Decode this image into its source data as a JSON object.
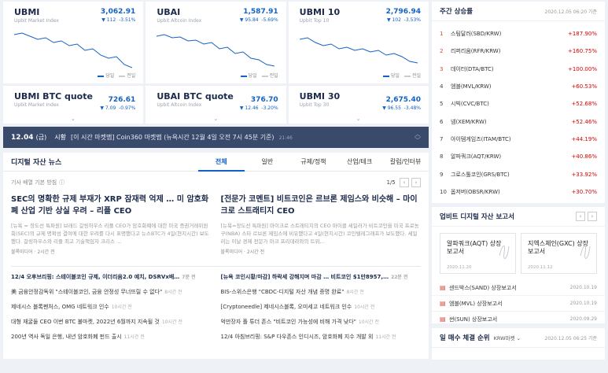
{
  "indices": [
    {
      "name": "UBMI",
      "sub": "Upbit Market Index",
      "value": "3,062.91",
      "change": "▼ 112",
      "rate": "-3.51%"
    },
    {
      "name": "UBAI",
      "sub": "Upbit Altcoin Index",
      "value": "1,587.91",
      "change": "▼ 95.84",
      "rate": "-5.69%"
    },
    {
      "name": "UBMI 10",
      "sub": "Upbit Top 10",
      "value": "2,796.94",
      "change": "▼ 102",
      "rate": "-3.53%"
    },
    {
      "name": "UBMI BTC quote",
      "sub": "Upbit Market Index",
      "value": "726.61",
      "change": "▼ 7.09",
      "rate": "-0.97%"
    },
    {
      "name": "UBAI BTC quote",
      "sub": "Upbit Altcoin Index",
      "value": "376.70",
      "change": "▼ 12.46",
      "rate": "-3.20%"
    },
    {
      "name": "UBMI 30",
      "sub": "Upbit Top 30",
      "value": "2,675.40",
      "change": "▼ 96.55",
      "rate": "-3.48%"
    }
  ],
  "legend": {
    "today": "당일",
    "prev": "전일"
  },
  "colors": {
    "accent": "#1261c4",
    "up": "#d60000",
    "ticker_bg": "#3a4a6b"
  },
  "ticker": {
    "date": "12.04",
    "day": "(금)",
    "label": "시황",
    "message": "[이 시간 마켓맵] Coin360 마켓맵 (뉴욕시간 12월 4일 오전 7시 45분 기준)",
    "time": "21:46"
  },
  "news": {
    "title": "디지털 자산 뉴스",
    "tabs": [
      "전체",
      "일반",
      "규제/정책",
      "산업/테크",
      "칼럼/인터뷰"
    ],
    "criteria": "기사 배열 기본 방침",
    "page": "1/5",
    "featured": [
      {
        "headline": "SEC의 명확한 규제 부재가 XRP 잠재력 억제 … 미 암호화폐 산업 기반 상실 우려 – 리플 CEO",
        "summary": "[뉴욕 = 장도선 특파원] 브래드 갈링하우스 리플 CEO가 암호화폐에 대한 미국 증권거래위원회(SEC)의 규제 명확성 결여에 대한 우려를 다시 표명했다고 뉴스BTC가 4일(현지시간) 보도했다. 갈링하우스와 리플 최고 기술책임자 크리스 …",
        "source": "블록미디어 · 2시간 전"
      },
      {
        "headline": "[전문가 코멘트] 비트코인은 르브론 제임스와 비슷해 – 마이크로 스트래티지 CEO",
        "summary": "[뉴욕=장도선 특파원] 마이크로 스트래티지의 CEO 마이클 세일러가 비트코인을 미국 프로농구(NBA) 스타 르브론 제임스에 비유했다고 4일(현지시간) 코인텔레그래프가 보도했다. 세일러는 이날 경제 전문가 마크 프리데라와의 트위…",
        "source": "블록미디어 · 2시간 전"
      }
    ],
    "list_left": [
      {
        "title": "12/4 오후브리핑: 스테이블코인 규제, 이더리움2.0 예치, DSRVx배…",
        "ago": "7분 전",
        "bold": true
      },
      {
        "title": "美 금융안정감독위 \"스테이블코인, 금융 안정성 무너뜨릴 수 없다\"",
        "ago": "8시간 전",
        "bold": false
      },
      {
        "title": "제네시스 블록펜처스, OMG 네트워크 인수",
        "ago": "10시간 전",
        "bold": false
      },
      {
        "title": "대형 재굴둘 CEO 이번 BTC 불마켓, 2022년 6월까지 지속될 것",
        "ago": "10시간 전",
        "bold": false
      },
      {
        "title": "200년 역사 독일 은행, 내년 암호화폐 펀드 출시",
        "ago": "11시간 전",
        "bold": false
      }
    ],
    "list_right": [
      {
        "title": "[뉴욕 코인시황/마감] 하락세 강해지며 마감 … 비트코인 $1만8957,…",
        "ago": "22분 전",
        "bold": true
      },
      {
        "title": "BIS-스위스은행 \"CBDC-디지털 자산 개념 증명 완료\"",
        "ago": "8시간 전",
        "bold": false
      },
      {
        "title": "[Cryptoneedle] 제네시스블록, 오미세고 네트워크 인수",
        "ago": "10시간 전",
        "bold": false
      },
      {
        "title": "억만장자 폴 튜더 존스 \"비트코인 가능성에 비해 가격 낮다\"",
        "ago": "10시간 전",
        "bold": false
      },
      {
        "title": "12/4 아침브리핑: S&P 다우존스 인디시즈, 암호화폐 지수 개발 외",
        "ago": "11시간 전",
        "bold": false
      }
    ]
  },
  "weekly": {
    "title": "주간 상승률",
    "timestamp": "2020.12.05 06:20 기준",
    "items": [
      {
        "rank": "1",
        "name": "스팀달러(SBD/KRW)",
        "pct": "+187.90%"
      },
      {
        "rank": "2",
        "name": "리퍼리움(RFR/KRW)",
        "pct": "+160.75%"
      },
      {
        "rank": "3",
        "name": "데이터(DTA/BTC)",
        "pct": "+100.00%"
      },
      {
        "rank": "4",
        "name": "엠블(MVL/KRW)",
        "pct": "+60.53%"
      },
      {
        "rank": "5",
        "name": "시빅(CVC/BTC)",
        "pct": "+52.68%"
      },
      {
        "rank": "6",
        "name": "넴(XEM/KRW)",
        "pct": "+52.46%"
      },
      {
        "rank": "7",
        "name": "아이템게임즈(ITAM/BTC)",
        "pct": "+44.19%"
      },
      {
        "rank": "8",
        "name": "알파쿼크(AQT/KRW)",
        "pct": "+40.86%"
      },
      {
        "rank": "9",
        "name": "그로스톨코인(GRS/BTC)",
        "pct": "+33.92%"
      },
      {
        "rank": "10",
        "name": "옵저버(OBSR/KRW)",
        "pct": "+30.70%"
      }
    ]
  },
  "reports": {
    "title": "업비트 디지털 자산 보고서",
    "cards": [
      {
        "title": "알파쿼크(AQT) 상장 보고서",
        "date": "2020.11.20"
      },
      {
        "title": "지엑스체인(GXC) 상장보고서",
        "date": "2020.11.12"
      }
    ],
    "items": [
      {
        "name": "샌드박스(SAND) 상장보고서",
        "date": "2020.10.19"
      },
      {
        "name": "엠블(MVL) 상장보고서",
        "date": "2020.10.19"
      },
      {
        "name": "썬(SUN) 상장보고서",
        "date": "2020.09.29"
      }
    ]
  },
  "daily": {
    "title": "일 매수 체결 순위",
    "market": "KRW마켓",
    "timestamp": "2020.12.05 06:25 기준"
  }
}
